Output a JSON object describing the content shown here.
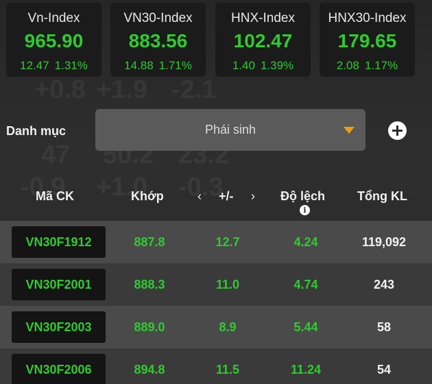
{
  "indices": [
    {
      "name": "Vn-Index",
      "value": "965.90",
      "change": "12.47",
      "percent": "1.31%"
    },
    {
      "name": "VN30-Index",
      "value": "883.56",
      "change": "14.88",
      "percent": "1.71%"
    },
    {
      "name": "HNX-Index",
      "value": "102.47",
      "change": "1.40",
      "percent": "1.39%"
    },
    {
      "name": "HNX30-Index",
      "value": "179.65",
      "change": "2.08",
      "percent": "1.17%"
    }
  ],
  "category": {
    "label": "Danh mục",
    "selected": "Phái sinh"
  },
  "table": {
    "headers": {
      "code": "Mã CK",
      "match": "Khớp",
      "change": "+/-",
      "deviation": "Độ lệch",
      "volume": "Tổng KL"
    },
    "rows": [
      {
        "code": "VN30F1912",
        "price": "887.8",
        "change": "12.7",
        "deviation": "4.24",
        "volume": "119,092"
      },
      {
        "code": "VN30F2001",
        "price": "888.3",
        "change": "11.0",
        "deviation": "4.74",
        "volume": "243"
      },
      {
        "code": "VN30F2003",
        "price": "889.0",
        "change": "8.9",
        "deviation": "5.44",
        "volume": "58"
      },
      {
        "code": "VN30F2006",
        "price": "894.8",
        "change": "11.5",
        "deviation": "11.24",
        "volume": "54"
      }
    ]
  },
  "colors": {
    "up": "#2ecc2e",
    "accent": "#f39c12",
    "background": "#2b2b2b"
  }
}
